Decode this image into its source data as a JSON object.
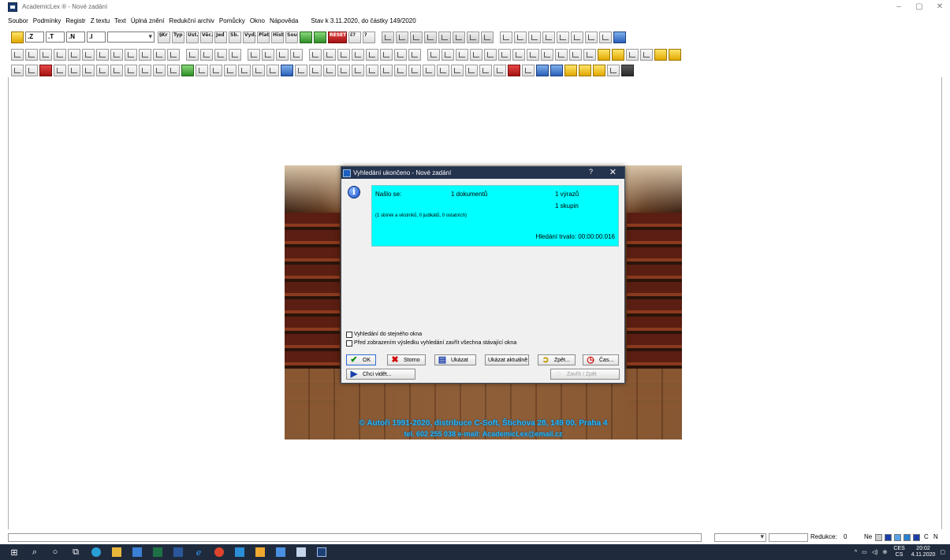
{
  "window": {
    "title": "AcademicLex ® - Nové zadání",
    "minimize": "–",
    "maximize": "▢",
    "close": "✕"
  },
  "menu": {
    "items": [
      "Soubor",
      "Podmínky",
      "Registr",
      "Z textu",
      "Text",
      "Úplná znění",
      "Redukční archiv",
      "Pomůcky",
      "Okno",
      "Nápověda"
    ],
    "status": "Stav k 3.11.2020, do částky 149/2020"
  },
  "toolbar1": {
    "field_z": ".Z",
    "field_t": ".T",
    "field_n": ".N",
    "field_i": ".I",
    "labels": [
      "§Kr",
      "Typ",
      "Ust.",
      "Věc.",
      "Jed",
      "Sb.",
      "Vyd.",
      "Plat",
      "Hist",
      "Sou",
      "RESET",
      "č?",
      "?"
    ]
  },
  "splash": {
    "line1": "© Autoři 1991-2020, distribuce C-Soft, Štichova 28, 149 00, Praha 4",
    "line2": "tel. 602 255 038    e-mail: AcademicLex@email.cz"
  },
  "dialog": {
    "title": "Vyhledání ukončeno - Nové zadání",
    "help": "?",
    "close": "✕",
    "info_glyph": "i",
    "result": {
      "found_label": "Našlo se:",
      "documents": "1 dokumentů",
      "expressions": "1 výrazů",
      "groups": "1 skupin",
      "breakdown": "(1 sbírek a věstníků, 0 judikátů, 0 ostatních)",
      "duration": "Hledání trvalo: 00:00:00.016"
    },
    "checkboxes": [
      "Vyhledání do stejného okna",
      "Před zobrazením výsledku vyhledání zavřít všechna stávající okna"
    ],
    "buttons": {
      "ok": "OK",
      "cancel": "Storno",
      "show": "Ukázat",
      "show_current": "Ukázat aktuálně",
      "back": "Zpět...",
      "time": "Čas...",
      "want_see": "Chci vidět...",
      "disabled": "Zavřít / Zpět"
    }
  },
  "statusbar": {
    "reduction_label": "Redukce:",
    "reduction_value": "0",
    "ne": "Ne",
    "c": "C",
    "n": "N"
  },
  "taskbar": {
    "lang1": "CES",
    "lang2": "CS",
    "time": "20:02",
    "date": "4.11.2020"
  },
  "colors": {
    "result_box": "#00ffff",
    "dialog_title": "#24334e",
    "splash_text": "#21b7ff",
    "taskbar": "#1f2b3d"
  }
}
